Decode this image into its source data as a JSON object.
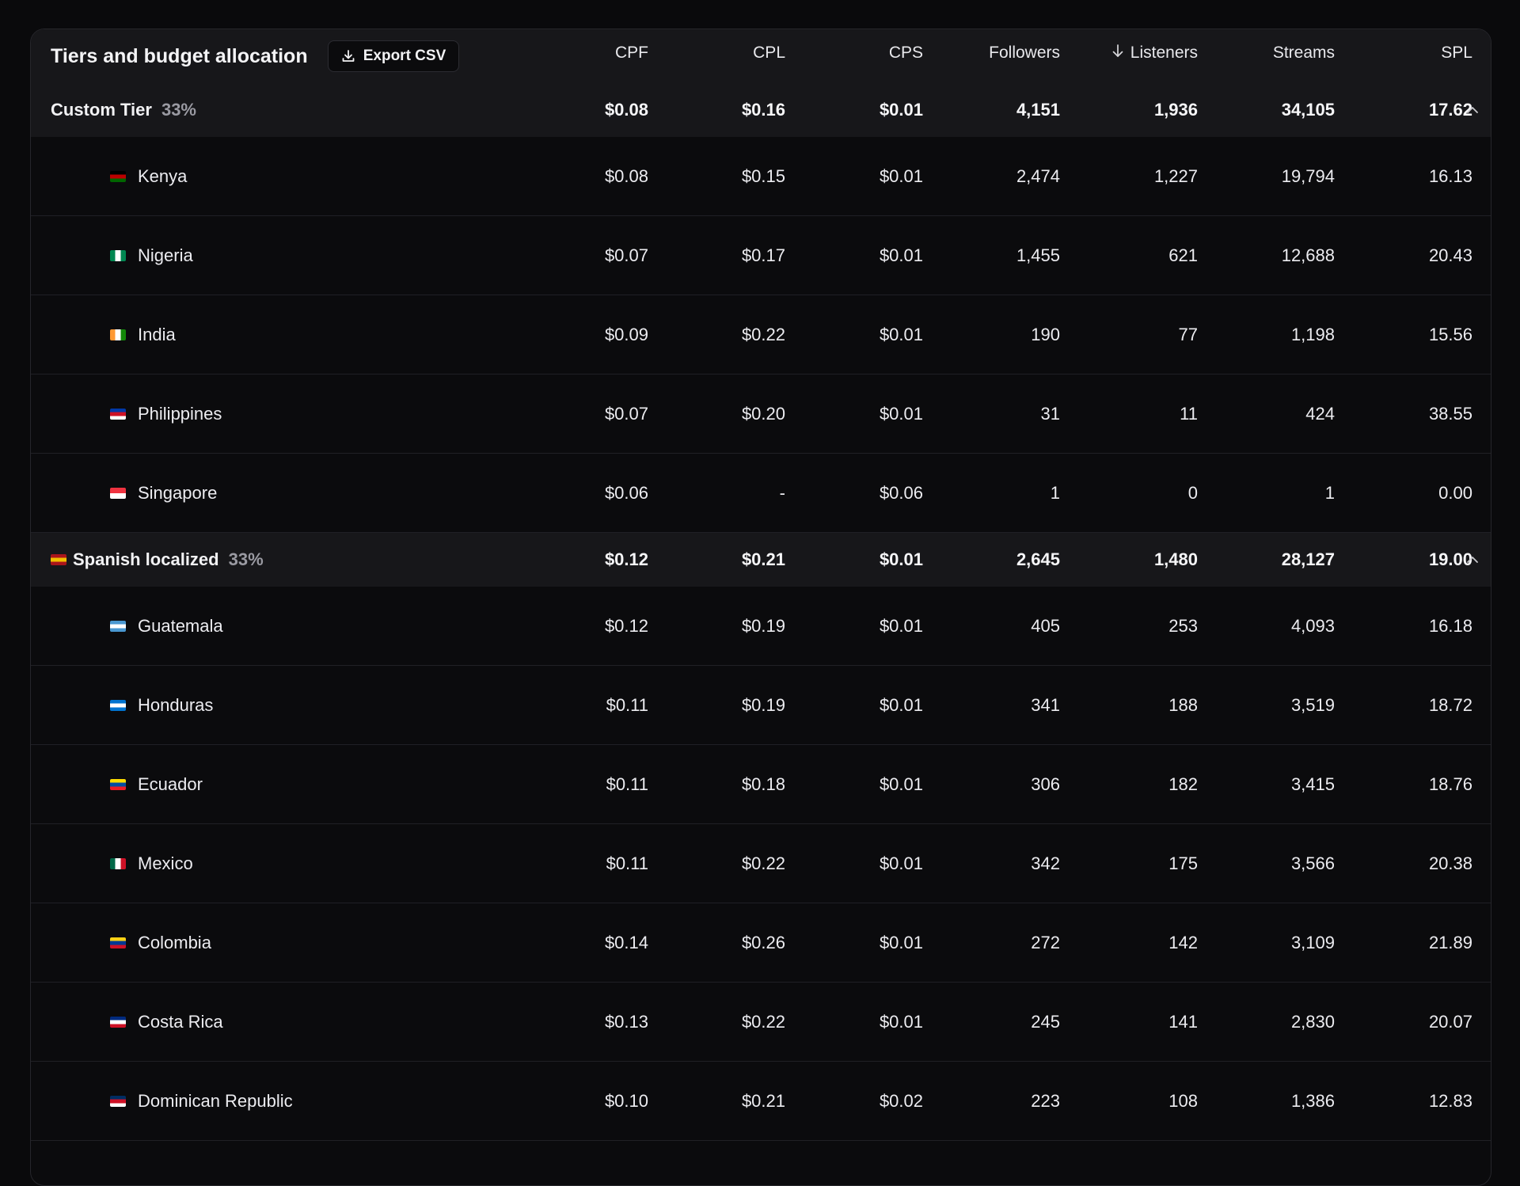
{
  "header": {
    "title": "Tiers and budget allocation",
    "export_label": "Export CSV",
    "columns": [
      "CPF",
      "CPL",
      "CPS",
      "Followers",
      "Listeners",
      "Streams",
      "SPL"
    ],
    "sorted_column": "Listeners",
    "sort_direction": "descending"
  },
  "groups": [
    {
      "name": "Custom Tier",
      "percent": "33%",
      "flag": "",
      "cpf": "$0.08",
      "cpl": "$0.16",
      "cps": "$0.01",
      "followers": "4,151",
      "listeners": "1,936",
      "streams": "34,105",
      "spl": "17.62",
      "expanded": true,
      "countries": [
        {
          "name": "Kenya",
          "flag": "ke",
          "cpf": "$0.08",
          "cpl": "$0.15",
          "cps": "$0.01",
          "followers": "2,474",
          "listeners": "1,227",
          "streams": "19,794",
          "spl": "16.13"
        },
        {
          "name": "Nigeria",
          "flag": "ng",
          "cpf": "$0.07",
          "cpl": "$0.17",
          "cps": "$0.01",
          "followers": "1,455",
          "listeners": "621",
          "streams": "12,688",
          "spl": "20.43"
        },
        {
          "name": "India",
          "flag": "in",
          "cpf": "$0.09",
          "cpl": "$0.22",
          "cps": "$0.01",
          "followers": "190",
          "listeners": "77",
          "streams": "1,198",
          "spl": "15.56"
        },
        {
          "name": "Philippines",
          "flag": "ph",
          "cpf": "$0.07",
          "cpl": "$0.20",
          "cps": "$0.01",
          "followers": "31",
          "listeners": "11",
          "streams": "424",
          "spl": "38.55"
        },
        {
          "name": "Singapore",
          "flag": "sg",
          "cpf": "$0.06",
          "cpl": "-",
          "cps": "$0.06",
          "followers": "1",
          "listeners": "0",
          "streams": "1",
          "spl": "0.00"
        }
      ]
    },
    {
      "name": "Spanish localized",
      "percent": "33%",
      "flag": "es",
      "cpf": "$0.12",
      "cpl": "$0.21",
      "cps": "$0.01",
      "followers": "2,645",
      "listeners": "1,480",
      "streams": "28,127",
      "spl": "19.00",
      "expanded": true,
      "countries": [
        {
          "name": "Guatemala",
          "flag": "gt",
          "cpf": "$0.12",
          "cpl": "$0.19",
          "cps": "$0.01",
          "followers": "405",
          "listeners": "253",
          "streams": "4,093",
          "spl": "16.18"
        },
        {
          "name": "Honduras",
          "flag": "hn",
          "cpf": "$0.11",
          "cpl": "$0.19",
          "cps": "$0.01",
          "followers": "341",
          "listeners": "188",
          "streams": "3,519",
          "spl": "18.72"
        },
        {
          "name": "Ecuador",
          "flag": "ec",
          "cpf": "$0.11",
          "cpl": "$0.18",
          "cps": "$0.01",
          "followers": "306",
          "listeners": "182",
          "streams": "3,415",
          "spl": "18.76"
        },
        {
          "name": "Mexico",
          "flag": "mx",
          "cpf": "$0.11",
          "cpl": "$0.22",
          "cps": "$0.01",
          "followers": "342",
          "listeners": "175",
          "streams": "3,566",
          "spl": "20.38"
        },
        {
          "name": "Colombia",
          "flag": "co",
          "cpf": "$0.14",
          "cpl": "$0.26",
          "cps": "$0.01",
          "followers": "272",
          "listeners": "142",
          "streams": "3,109",
          "spl": "21.89"
        },
        {
          "name": "Costa Rica",
          "flag": "cr",
          "cpf": "$0.13",
          "cpl": "$0.22",
          "cps": "$0.01",
          "followers": "245",
          "listeners": "141",
          "streams": "2,830",
          "spl": "20.07"
        },
        {
          "name": "Dominican Republic",
          "flag": "do",
          "cpf": "$0.10",
          "cpl": "$0.21",
          "cps": "$0.02",
          "followers": "223",
          "listeners": "108",
          "streams": "1,386",
          "spl": "12.83"
        }
      ]
    }
  ],
  "flag_colors": {
    "ke": [
      "#000000",
      "#bb0000",
      "#006600"
    ],
    "ng": [
      "#008751",
      "#ffffff",
      "#008751"
    ],
    "in": [
      "#ff9933",
      "#ffffff",
      "#138808"
    ],
    "ph": [
      "#0038a8",
      "#ce1126",
      "#ffffff"
    ],
    "sg": [
      "#ef3340",
      "#ffffff"
    ],
    "es": [
      "#aa151b",
      "#f1bf00",
      "#aa151b"
    ],
    "gt": [
      "#4997d0",
      "#ffffff",
      "#4997d0"
    ],
    "hn": [
      "#0073cf",
      "#ffffff",
      "#0073cf"
    ],
    "ec": [
      "#ffdd00",
      "#034ea2",
      "#ed1c24"
    ],
    "mx": [
      "#006847",
      "#ffffff",
      "#ce1126"
    ],
    "co": [
      "#fcd116",
      "#003893",
      "#ce1126"
    ],
    "cr": [
      "#002b7f",
      "#ffffff",
      "#ce1126"
    ],
    "do": [
      "#002d62",
      "#ce1126",
      "#ffffff"
    ]
  }
}
